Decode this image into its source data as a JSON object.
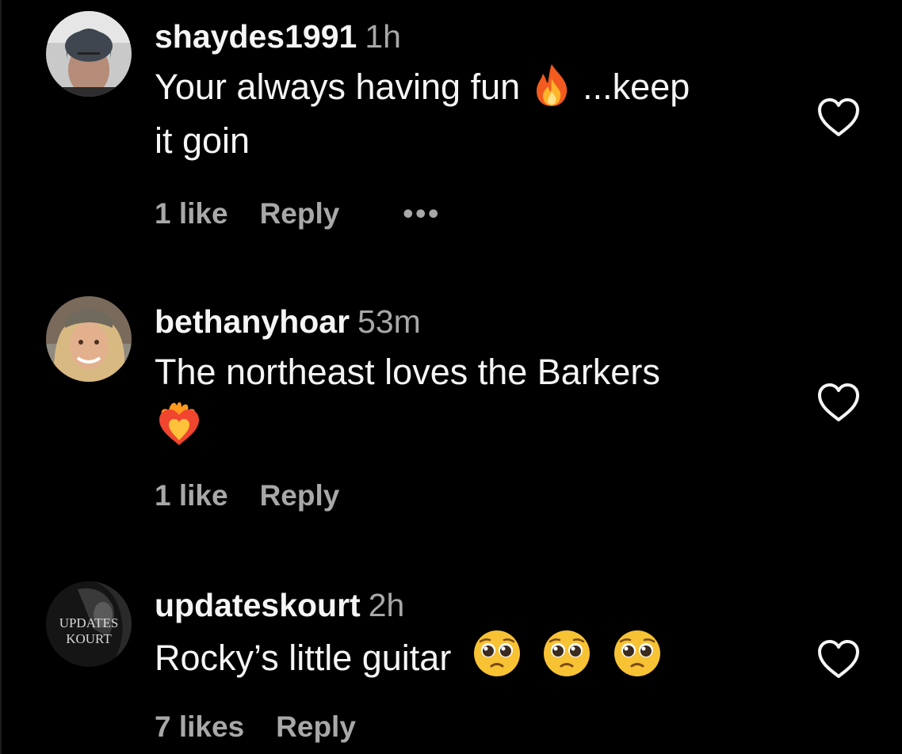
{
  "comments": [
    {
      "username": "shaydes1991",
      "time": "1h",
      "text_part1": "Your always having fun",
      "emoji1": "fire-emoji",
      "text_part2": "...keep",
      "text_part3": "it goin",
      "likes": "1 like",
      "reply": "Reply",
      "more": "•••",
      "avatar": "user-photo-avatar"
    },
    {
      "username": "bethanyhoar",
      "time": "53m",
      "text_part1": "The northeast loves the Barkers",
      "emoji1": "heart-on-fire-emoji",
      "likes": "1 like",
      "reply": "Reply",
      "avatar": "user-photo-avatar"
    },
    {
      "username": "updateskourt",
      "time": "2h",
      "text_part1": "Rocky’s little guitar",
      "emoji1": "pleading-face-emoji",
      "likes": "7 likes",
      "reply": "Reply",
      "avatar_text_line1": "UPDATES",
      "avatar_text_line2": "KOURT"
    }
  ],
  "icons": {
    "like": "heart-outline-icon"
  },
  "colors": {
    "background": "#000000",
    "primary_text": "#f5f5f5",
    "secondary_text": "#a8a8a8"
  }
}
